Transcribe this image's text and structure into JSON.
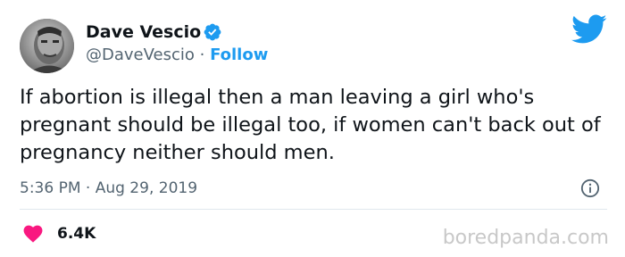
{
  "author": {
    "display_name": "Dave Vescio",
    "handle": "@DaveVescio",
    "separator": " · ",
    "follow_label": "Follow",
    "verified_icon": "verified-badge-icon"
  },
  "tweet": {
    "text": "If abortion is illegal then a man leaving a girl who's pregnant should be illegal too, if women can't back out of pregnancy neither should men.",
    "timestamp": "5:36 PM · Aug 29, 2019"
  },
  "engagement": {
    "likes": "6.4K",
    "like_icon": "heart-icon"
  },
  "watermark": "boredpanda.com",
  "colors": {
    "accent": "#1d9bf0",
    "heart": "#f91880",
    "muted_text": "#536471",
    "divider": "#e1e8ed"
  }
}
